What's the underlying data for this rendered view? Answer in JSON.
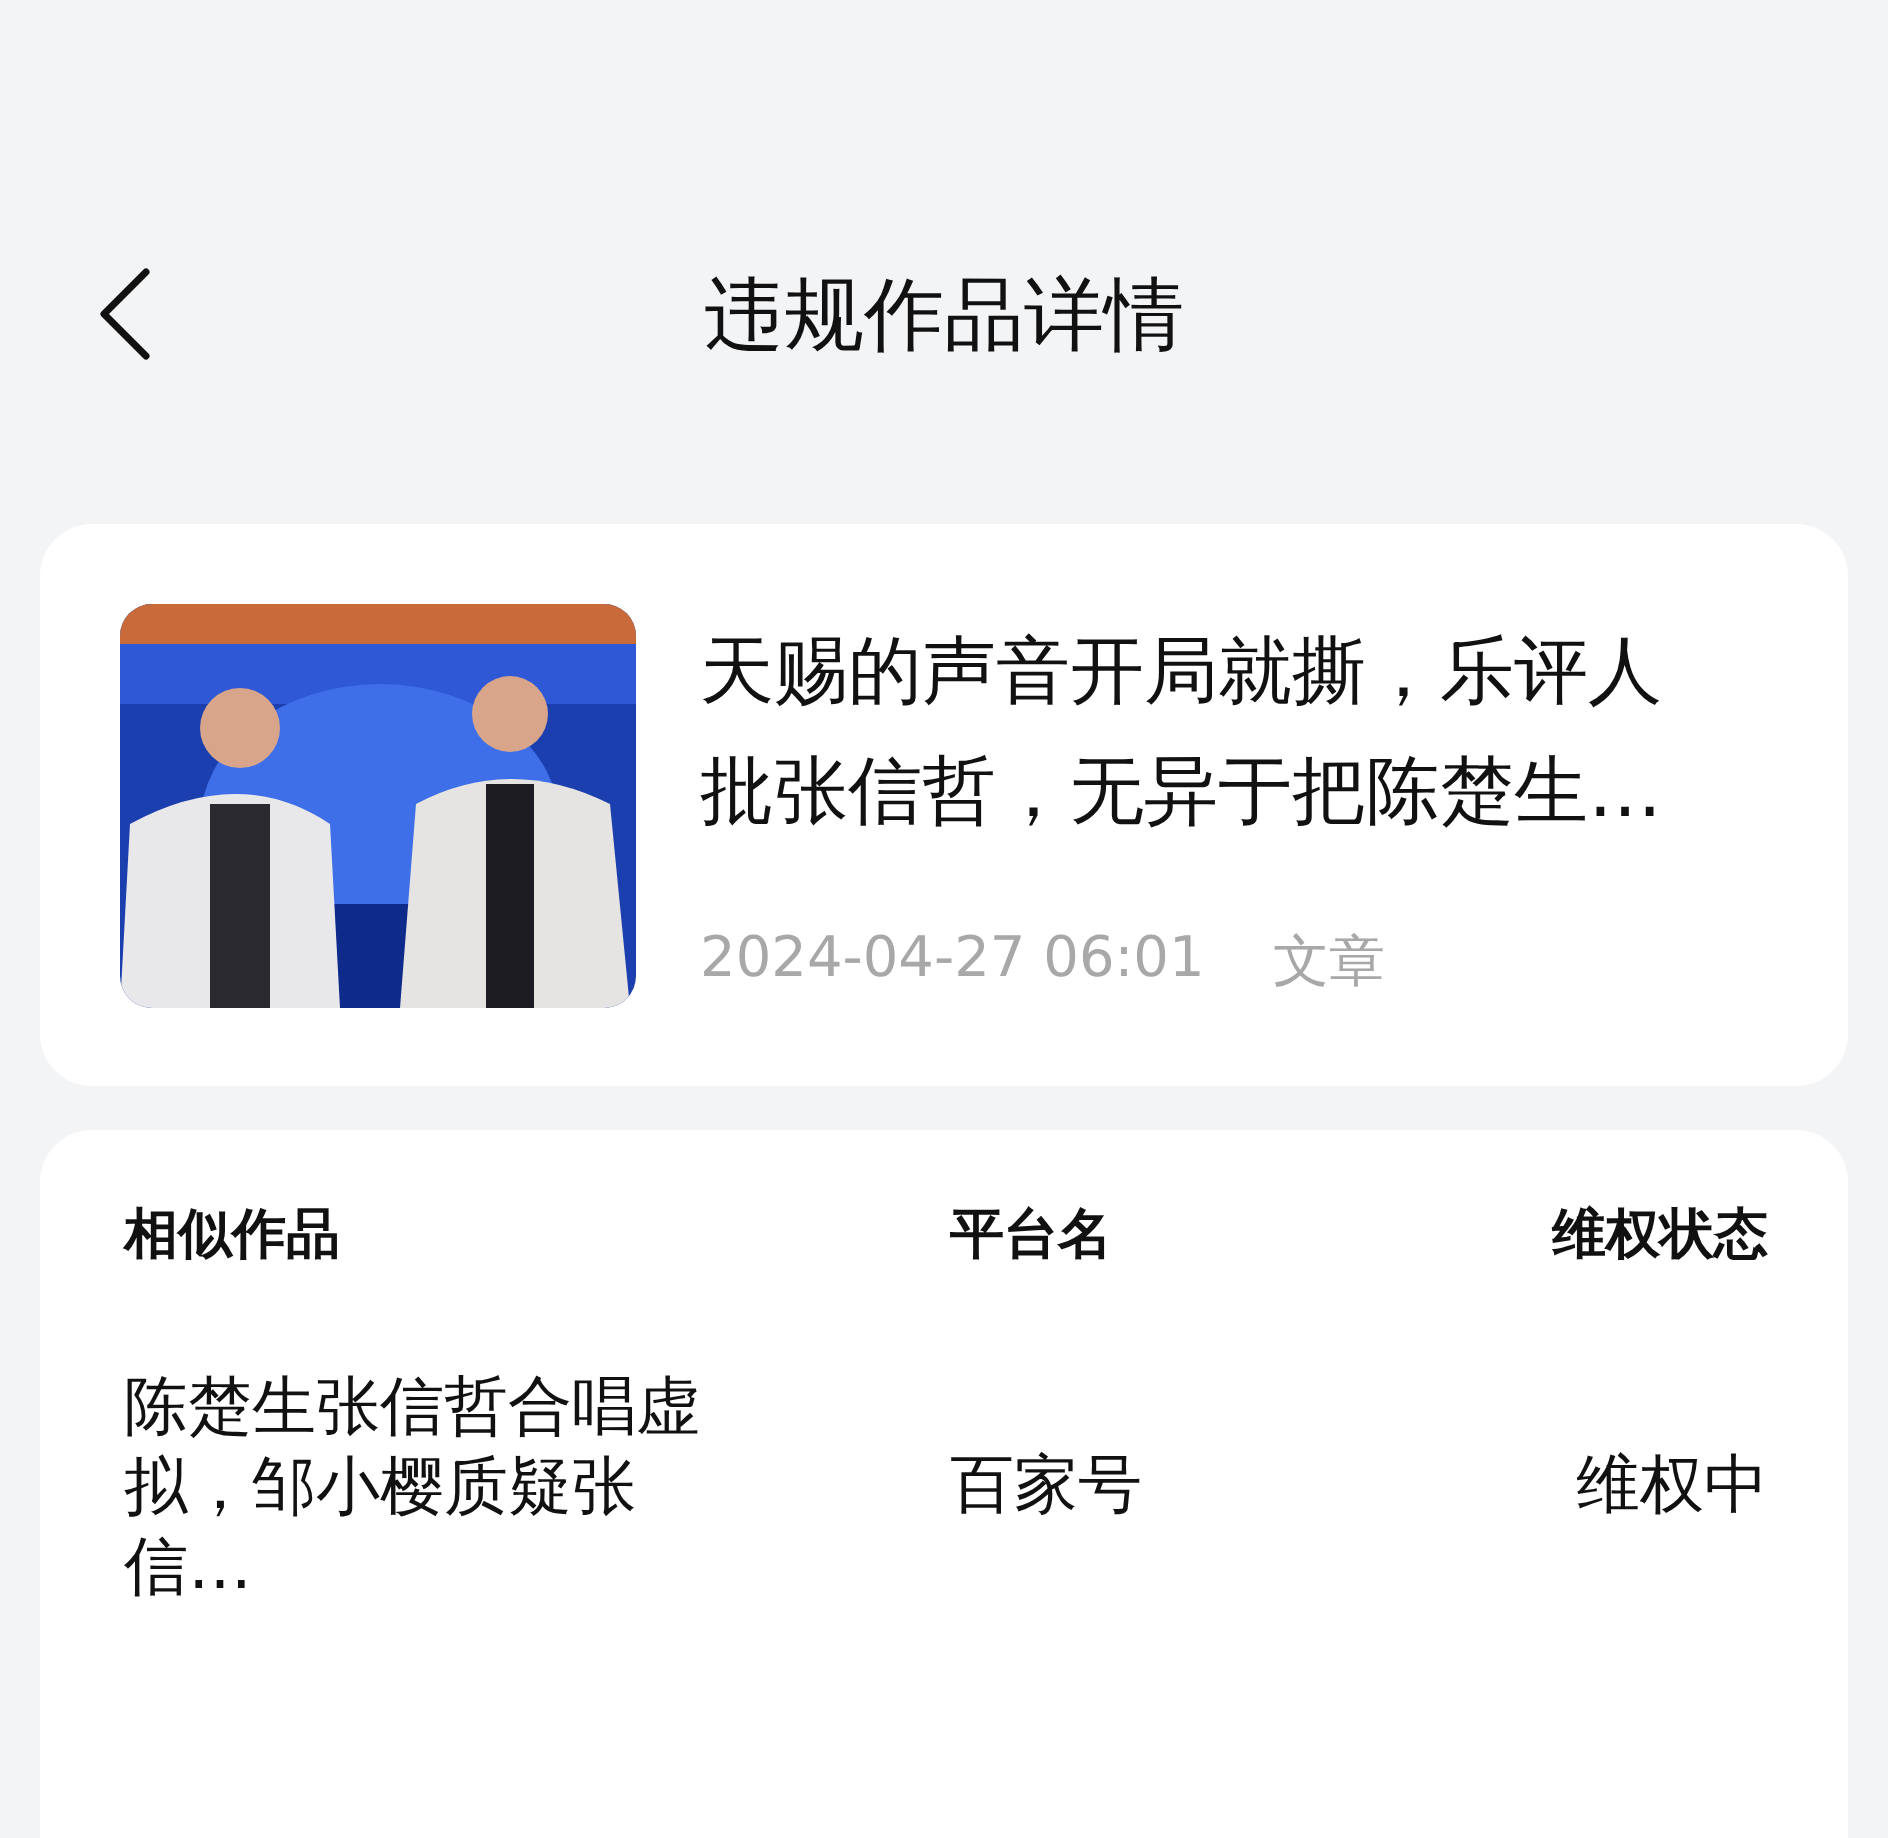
{
  "header": {
    "title": "违规作品详情"
  },
  "work": {
    "title": "天赐的声音开局就撕，乐评人批张信哲，无异于把陈楚生…",
    "date": "2024-04-27 06:01",
    "type": "文章"
  },
  "table": {
    "columns": [
      "相似作品",
      "平台名",
      "维权状态"
    ],
    "rows": [
      {
        "work": "陈楚生张信哲合唱虚拟，邹小樱质疑张信…",
        "platform": "百家号",
        "status": "维权中"
      }
    ]
  }
}
